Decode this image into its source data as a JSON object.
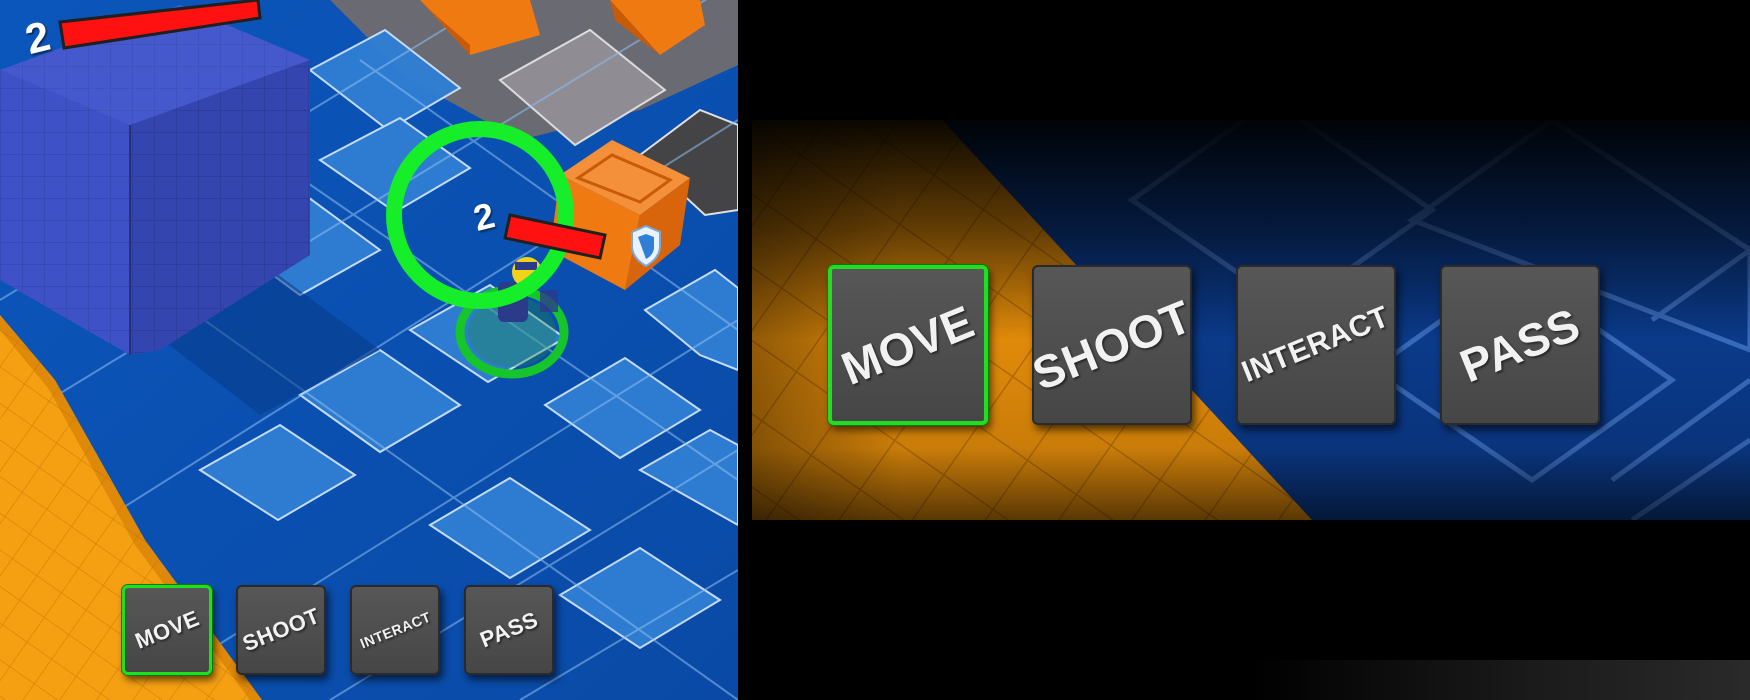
{
  "scene": {
    "enemy_block": {
      "hp_value": "2"
    },
    "player": {
      "hp_value": "2",
      "status_icon": "shield-icon"
    },
    "selection_ring_color": "#16ee2a",
    "floor_color": "#0d5fc4",
    "hazard_color": "#f59a0a",
    "crate_color": "#f07a12"
  },
  "action_bar": {
    "buttons": [
      {
        "label": "MOVE",
        "active": true
      },
      {
        "label": "SHOOT",
        "active": false
      },
      {
        "label": "INTERACT",
        "active": false
      },
      {
        "label": "PASS",
        "active": false
      }
    ],
    "active_color": "#22dd22"
  },
  "zoom_inset": {
    "buttons": [
      {
        "label": "MOVE",
        "active": true
      },
      {
        "label": "SHOOT",
        "active": false
      },
      {
        "label": "INTERACT",
        "active": false
      },
      {
        "label": "PASS",
        "active": false
      }
    ]
  }
}
